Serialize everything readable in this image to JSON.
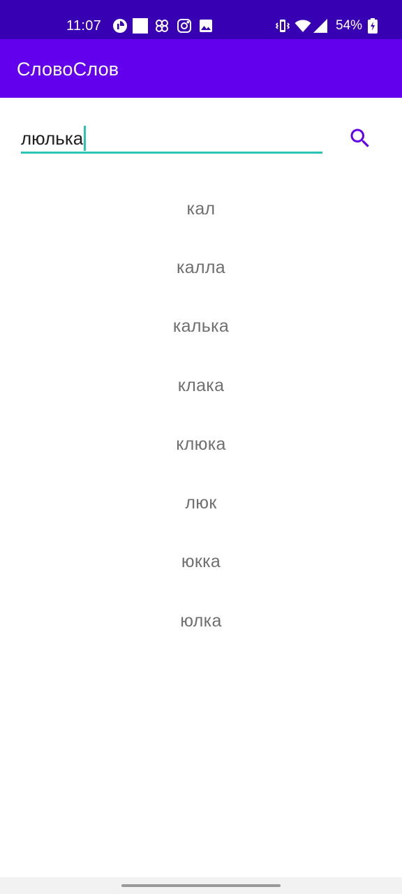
{
  "status_bar": {
    "time": "11:07",
    "battery_percent": "54%",
    "notification_icons": [
      "circle-notification-icon",
      "square-notification-icon",
      "pinwheel-notification-icon",
      "instagram-icon",
      "gallery-icon"
    ],
    "system_icons": [
      "vibrate-icon",
      "wifi-icon",
      "cellular-signal-icon",
      "battery-icon"
    ],
    "background_color": "#3700b3"
  },
  "app_bar": {
    "title": "СловоСлов",
    "background_color": "#6200ee"
  },
  "search": {
    "value": "люлька",
    "underline_color": "#2bc4b4",
    "button_icon": "search-icon",
    "button_color": "#6200ee"
  },
  "results": [
    "кал",
    "калла",
    "калька",
    "клака",
    "клюка",
    "люк",
    "юкка",
    "юлка"
  ]
}
